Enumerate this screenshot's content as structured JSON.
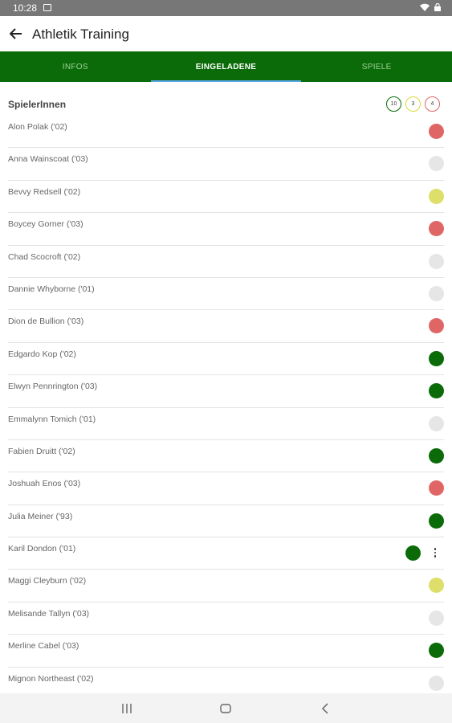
{
  "status_bar": {
    "time": "10:28"
  },
  "app_bar": {
    "title": "Athletik Training"
  },
  "tabs": [
    {
      "label": "INFOS",
      "active": false
    },
    {
      "label": "EINGELADENE",
      "active": true
    },
    {
      "label": "SPIELE",
      "active": false
    }
  ],
  "section": {
    "title": "SpielerInnen",
    "counts": [
      {
        "value": "10",
        "color": "#0a6b08"
      },
      {
        "value": "3",
        "color": "#d9d93a"
      },
      {
        "value": "4",
        "color": "#e06666"
      }
    ]
  },
  "players": [
    {
      "name": "Alon Polak ('02)",
      "status": "red"
    },
    {
      "name": "Anna Wainscoat ('03)",
      "status": "grey"
    },
    {
      "name": "Bevvy Redsell ('02)",
      "status": "yellow"
    },
    {
      "name": "Boycey Gorner ('03)",
      "status": "red"
    },
    {
      "name": "Chad Scocroft ('02)",
      "status": "grey"
    },
    {
      "name": "Dannie Whyborne ('01)",
      "status": "grey"
    },
    {
      "name": "Dion de Bullion ('03)",
      "status": "red"
    },
    {
      "name": "Edgardo Kop ('02)",
      "status": "green"
    },
    {
      "name": "Elwyn Pennrington ('03)",
      "status": "green"
    },
    {
      "name": "Emmalynn Tomich ('01)",
      "status": "grey"
    },
    {
      "name": "Fabien Druitt ('02)",
      "status": "green"
    },
    {
      "name": "Joshuah Enos ('03)",
      "status": "red"
    },
    {
      "name": "Julia Meiner ('93)",
      "status": "green"
    },
    {
      "name": "Karil Dondon ('01)",
      "status": "green",
      "menu": true
    },
    {
      "name": "Maggi Cleyburn ('02)",
      "status": "yellow"
    },
    {
      "name": "Melisande Tallyn ('03)",
      "status": "grey"
    },
    {
      "name": "Merline Cabel ('03)",
      "status": "green"
    },
    {
      "name": "Mignon Northeast ('02)",
      "status": "grey"
    }
  ],
  "status_colors": {
    "red": "#e06666",
    "grey": "#e6e6e6",
    "yellow": "#dede6a",
    "green": "#0a6b08"
  },
  "icons": {
    "back": "arrow-left-icon",
    "more": "more-vert-icon",
    "nav_recents": "recents-icon",
    "nav_home": "home-icon",
    "nav_back": "nav-back-icon"
  }
}
